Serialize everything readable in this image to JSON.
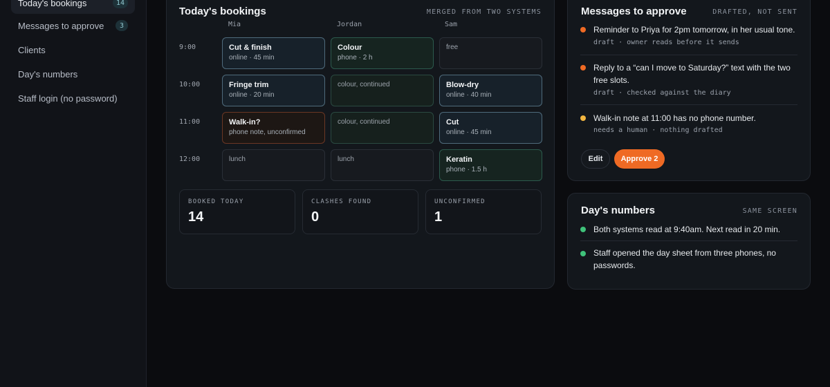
{
  "sidebar": {
    "items": [
      {
        "label": "Today's bookings",
        "badge": "14"
      },
      {
        "label": "Messages to approve",
        "badge": "3"
      },
      {
        "label": "Clients"
      },
      {
        "label": "Day's numbers"
      },
      {
        "label": "Staff login (no password)"
      }
    ]
  },
  "bookings": {
    "title": "Today's bookings",
    "tag": "MERGED FROM TWO SYSTEMS",
    "staff": [
      "Mia",
      "Jordan",
      "Sam"
    ],
    "times": [
      "9:00",
      "10:00",
      "11:00",
      "12:00"
    ],
    "slots": [
      {
        "title": "Cut & finish",
        "sub": "online · 45 min"
      },
      {
        "title": "Colour",
        "sub": "phone · 2 h"
      },
      {
        "text": "free"
      },
      {
        "title": "Fringe trim",
        "sub": "online · 20 min"
      },
      {
        "text": "colour, continued"
      },
      {
        "title": "Blow-dry",
        "sub": "online · 40 min"
      },
      {
        "title": "Walk-in?",
        "sub": "phone note, unconfirmed"
      },
      {
        "text": "colour, continued"
      },
      {
        "title": "Cut",
        "sub": "online · 45 min"
      },
      {
        "text": "lunch"
      },
      {
        "text": "lunch"
      },
      {
        "title": "Keratin",
        "sub": "phone · 1.5 h"
      }
    ],
    "stats": [
      {
        "label": "BOOKED TODAY",
        "value": "14"
      },
      {
        "label": "CLASHES FOUND",
        "value": "0"
      },
      {
        "label": "UNCONFIRMED",
        "value": "1"
      }
    ]
  },
  "messages": {
    "title": "Messages to approve",
    "tag": "DRAFTED, NOT SENT",
    "items": [
      {
        "text": "Reminder to Priya for 2pm tomorrow, in her usual tone.",
        "meta": "draft · owner reads before it sends",
        "color": "#ef6a24"
      },
      {
        "text": "Reply to a “can I move to Saturday?” text with the two free slots.",
        "meta": "draft · checked against the diary",
        "color": "#ef6a24"
      },
      {
        "text": "Walk-in note at 11:00 has no phone number.",
        "meta": "needs a human · nothing drafted",
        "color": "#f2b640"
      }
    ],
    "edit_label": "Edit",
    "approve_label": "Approve 2"
  },
  "numbers": {
    "title": "Day's numbers",
    "tag": "SAME SCREEN",
    "items": [
      {
        "text": "Both systems read at 9:40am. Next read in 20 min.",
        "color": "#3fc27a"
      },
      {
        "text": "Staff opened the day sheet from three phones, no passwords.",
        "color": "#3fc27a"
      }
    ]
  }
}
